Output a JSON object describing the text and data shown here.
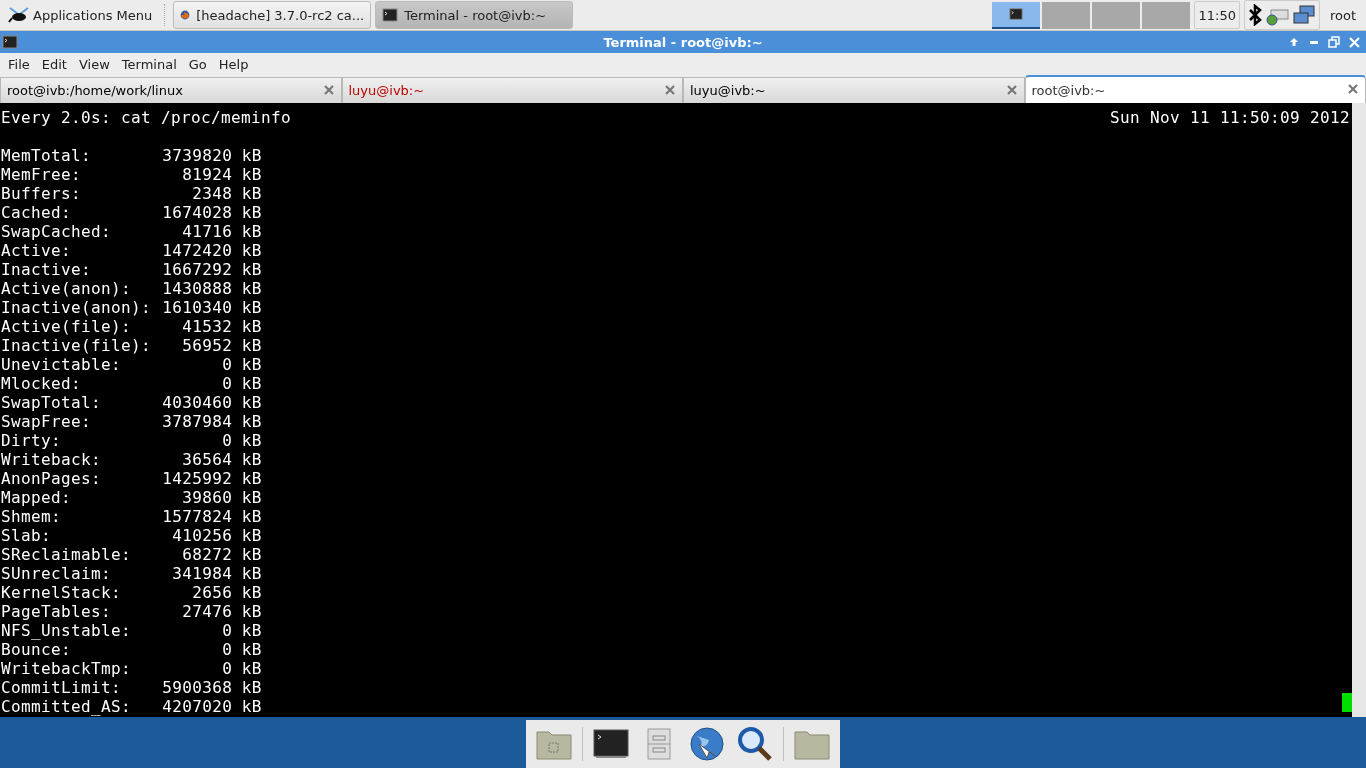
{
  "top_panel": {
    "app_menu": "Applications Menu",
    "tasks": [
      {
        "label": "[headache] 3.7.0-rc2 ca...",
        "kind": "browser",
        "selected": false
      },
      {
        "label": "Terminal - root@ivb:~",
        "kind": "terminal",
        "selected": true
      }
    ],
    "workspaces": [
      {
        "selected": true
      },
      {
        "selected": false
      },
      {
        "selected": false
      },
      {
        "selected": false
      }
    ],
    "clock": "11:50",
    "user": "root"
  },
  "window": {
    "title": "Terminal - root@ivb:~"
  },
  "menu": [
    "File",
    "Edit",
    "View",
    "Terminal",
    "Go",
    "Help"
  ],
  "tabs": [
    {
      "label": "root@ivb:/home/work/linux",
      "color": "#000000",
      "selected": false
    },
    {
      "label": "luyu@ivb:~",
      "color": "#c00000",
      "selected": false
    },
    {
      "label": "luyu@ivb:~",
      "color": "#000000",
      "selected": false
    },
    {
      "label": "root@ivb:~",
      "color": "#333333",
      "selected": true
    }
  ],
  "terminal": {
    "command": "Every 2.0s: cat /proc/meminfo",
    "timestamp": "Sun Nov 11 11:50:09 2012",
    "rows": [
      {
        "label": "MemTotal:",
        "value": "3739820",
        "unit": "kB"
      },
      {
        "label": "MemFree:",
        "value": "81924",
        "unit": "kB"
      },
      {
        "label": "Buffers:",
        "value": "2348",
        "unit": "kB"
      },
      {
        "label": "Cached:",
        "value": "1674028",
        "unit": "kB"
      },
      {
        "label": "SwapCached:",
        "value": "41716",
        "unit": "kB"
      },
      {
        "label": "Active:",
        "value": "1472420",
        "unit": "kB"
      },
      {
        "label": "Inactive:",
        "value": "1667292",
        "unit": "kB"
      },
      {
        "label": "Active(anon):",
        "value": "1430888",
        "unit": "kB"
      },
      {
        "label": "Inactive(anon):",
        "value": "1610340",
        "unit": "kB"
      },
      {
        "label": "Active(file):",
        "value": "41532",
        "unit": "kB"
      },
      {
        "label": "Inactive(file):",
        "value": "56952",
        "unit": "kB"
      },
      {
        "label": "Unevictable:",
        "value": "0",
        "unit": "kB"
      },
      {
        "label": "Mlocked:",
        "value": "0",
        "unit": "kB"
      },
      {
        "label": "SwapTotal:",
        "value": "4030460",
        "unit": "kB"
      },
      {
        "label": "SwapFree:",
        "value": "3787984",
        "unit": "kB"
      },
      {
        "label": "Dirty:",
        "value": "0",
        "unit": "kB"
      },
      {
        "label": "Writeback:",
        "value": "36564",
        "unit": "kB"
      },
      {
        "label": "AnonPages:",
        "value": "1425992",
        "unit": "kB"
      },
      {
        "label": "Mapped:",
        "value": "39860",
        "unit": "kB"
      },
      {
        "label": "Shmem:",
        "value": "1577824",
        "unit": "kB"
      },
      {
        "label": "Slab:",
        "value": "410256",
        "unit": "kB"
      },
      {
        "label": "SReclaimable:",
        "value": "68272",
        "unit": "kB"
      },
      {
        "label": "SUnreclaim:",
        "value": "341984",
        "unit": "kB"
      },
      {
        "label": "KernelStack:",
        "value": "2656",
        "unit": "kB"
      },
      {
        "label": "PageTables:",
        "value": "27476",
        "unit": "kB"
      },
      {
        "label": "NFS_Unstable:",
        "value": "0",
        "unit": "kB"
      },
      {
        "label": "Bounce:",
        "value": "0",
        "unit": "kB"
      },
      {
        "label": "WritebackTmp:",
        "value": "0",
        "unit": "kB"
      },
      {
        "label": "CommitLimit:",
        "value": "5900368",
        "unit": "kB"
      },
      {
        "label": "Committed_AS:",
        "value": "4207020",
        "unit": "kB"
      }
    ]
  },
  "dock": [
    {
      "kind": "home-folder"
    },
    {
      "kind": "terminal"
    },
    {
      "kind": "cabinet"
    },
    {
      "kind": "globe"
    },
    {
      "kind": "search"
    },
    {
      "kind": "folder"
    }
  ]
}
